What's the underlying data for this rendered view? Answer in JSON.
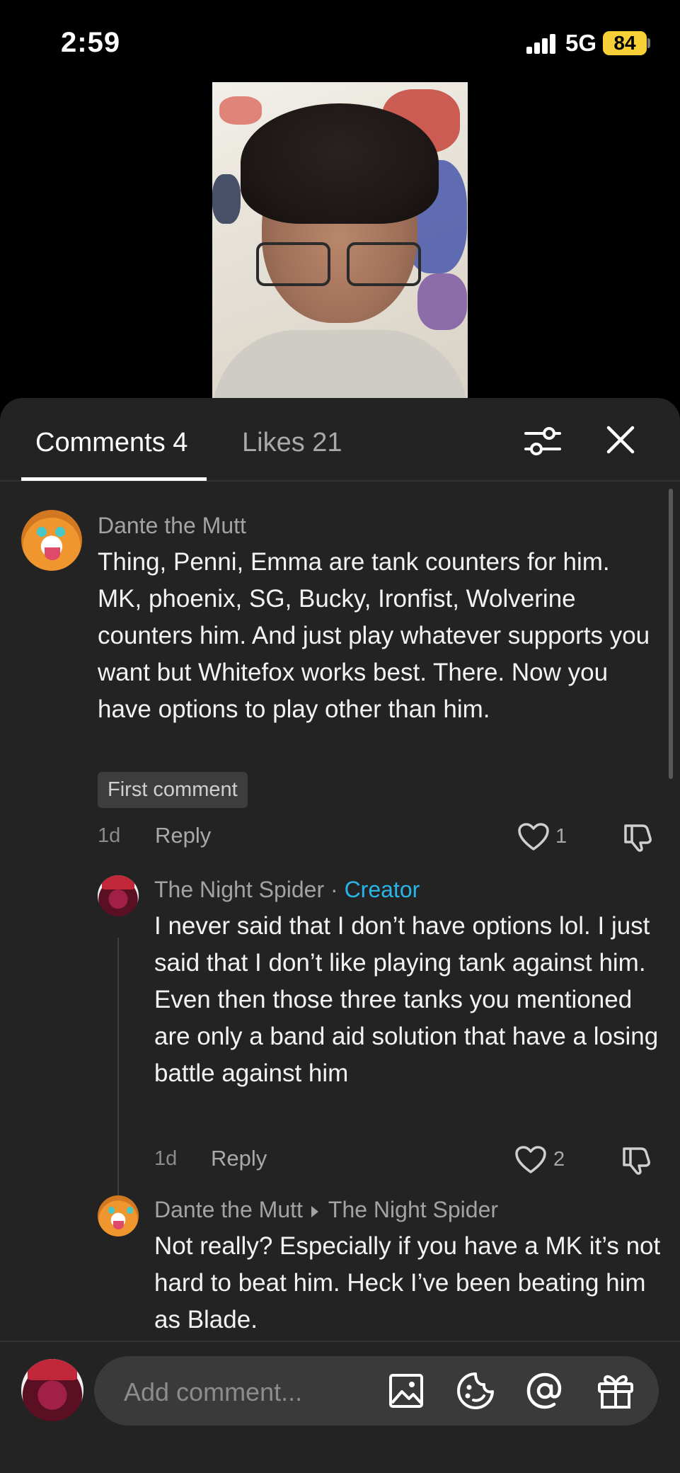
{
  "status_bar": {
    "time": "2:59",
    "network": "5G",
    "battery": "84"
  },
  "tabs": {
    "comments": "Comments 4",
    "likes": "Likes 21"
  },
  "comments": [
    {
      "author": "Dante the Mutt",
      "text": "Thing, Penni, Emma are tank counters for him. MK, phoenix, SG, Bucky, Ironfist, Wolverine counters him. And just play whatever supports you want but Whitefox works best. There. Now you have options to play other than him.",
      "badge": "First comment",
      "time": "1d",
      "reply_label": "Reply",
      "likes": "1"
    },
    {
      "author": "The Night Spider",
      "author_suffix": " · ",
      "creator_label": "Creator",
      "text": "I never said that I don’t have options lol. I just said that I don’t like playing tank against him. Even then those three tanks you mentioned are only a band aid solution that have a losing battle against him",
      "time": "1d",
      "reply_label": "Reply",
      "likes": "2"
    },
    {
      "author": "Dante the Mutt",
      "reply_to": "The Night Spider",
      "text": "Not really? Especially if you have a MK it’s not hard to beat him. Heck I’ve been beating him as Blade."
    }
  ],
  "composer": {
    "placeholder": "Add comment..."
  },
  "icons": [
    "filter-icon",
    "close-icon",
    "heart-icon",
    "dislike-icon",
    "image-icon",
    "emoji-icon",
    "mention-icon",
    "gift-icon"
  ],
  "colors": {
    "background": "#232323",
    "creator": "#29b5e8",
    "battery": "#f7d038"
  }
}
